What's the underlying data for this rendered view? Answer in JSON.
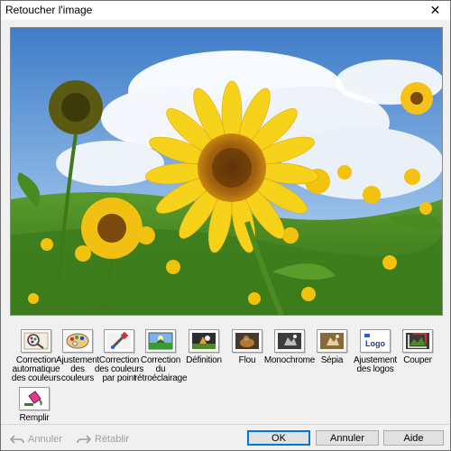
{
  "window": {
    "title": "Retoucher l'image",
    "close_glyph": "✕"
  },
  "preview": {
    "description_icon": "sunflower-photo"
  },
  "tools": [
    {
      "id": "auto-color",
      "label": "Correction\nautomatique\ndes couleurs",
      "icon": "auto-color-correction-icon"
    },
    {
      "id": "color-adjust",
      "label": "Ajustement\ndes\ncouleurs",
      "icon": "palette-icon"
    },
    {
      "id": "spot-color",
      "label": "Correction\ndes couleurs\npar point",
      "icon": "eyedropper-icon"
    },
    {
      "id": "backlight",
      "label": "Correction\ndu\nrétroéclairage",
      "icon": "backlight-correction-icon"
    },
    {
      "id": "sharpness",
      "label": "Définition",
      "icon": "sharpness-icon"
    },
    {
      "id": "blur",
      "label": "Flou",
      "icon": "blur-icon"
    },
    {
      "id": "monochrome",
      "label": "Monochrome",
      "icon": "monochrome-icon"
    },
    {
      "id": "sepia",
      "label": "Sépia",
      "icon": "sepia-icon"
    },
    {
      "id": "logo",
      "label": "Ajustement\ndes logos",
      "icon": "logo-icon",
      "logo_text": "Logo"
    },
    {
      "id": "crop",
      "label": "Couper",
      "icon": "crop-icon"
    },
    {
      "id": "fill",
      "label": "Remplir",
      "icon": "fill-bucket-icon"
    }
  ],
  "footer": {
    "undo_label": "Annuler",
    "redo_label": "Rétablir",
    "ok_label": "OK",
    "cancel_label": "Annuler",
    "help_label": "Aide"
  },
  "colors": {
    "accent": "#0078d7",
    "disabled_text": "#a0a0a0"
  }
}
